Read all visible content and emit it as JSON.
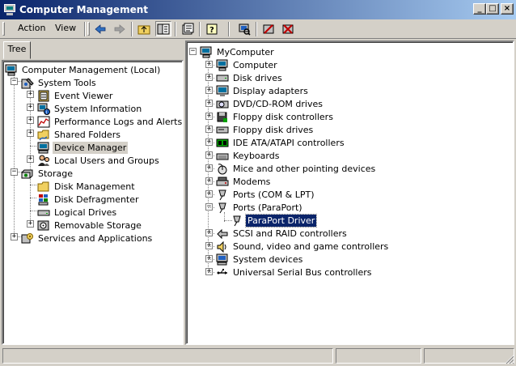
{
  "window": {
    "title": "Computer Management"
  },
  "menu": {
    "action": "Action",
    "view": "View"
  },
  "tabs": {
    "tree": "Tree"
  },
  "left_tree": {
    "root": "Computer Management (Local)",
    "system_tools": "System Tools",
    "event_viewer": "Event Viewer",
    "system_information": "System Information",
    "perf_logs": "Performance Logs and Alerts",
    "shared_folders": "Shared Folders",
    "device_manager": "Device Manager",
    "local_users": "Local Users and Groups",
    "storage": "Storage",
    "disk_management": "Disk Management",
    "disk_defrag": "Disk Defragmenter",
    "logical_drives": "Logical Drives",
    "removable_storage": "Removable Storage",
    "services_apps": "Services and Applications"
  },
  "device_tree": {
    "root": "MyComputer",
    "categories": [
      {
        "label": "Computer",
        "icon": "computer-icon"
      },
      {
        "label": "Disk drives",
        "icon": "disk-drive-icon"
      },
      {
        "label": "Display adapters",
        "icon": "display-adapter-icon"
      },
      {
        "label": "DVD/CD-ROM drives",
        "icon": "cdrom-icon"
      },
      {
        "label": "Floppy disk controllers",
        "icon": "floppy-controller-icon"
      },
      {
        "label": "Floppy disk drives",
        "icon": "floppy-drive-icon"
      },
      {
        "label": "IDE ATA/ATAPI controllers",
        "icon": "ide-controller-icon"
      },
      {
        "label": "Keyboards",
        "icon": "keyboard-icon"
      },
      {
        "label": "Mice and other pointing devices",
        "icon": "mouse-icon"
      },
      {
        "label": "Modems",
        "icon": "modem-icon"
      },
      {
        "label": "Ports (COM & LPT)",
        "icon": "port-icon"
      },
      {
        "label": "Ports (ParaPort)",
        "icon": "port-icon"
      },
      {
        "label": "SCSI and RAID controllers",
        "icon": "scsi-icon"
      },
      {
        "label": "Sound, video and game controllers",
        "icon": "sound-icon"
      },
      {
        "label": "System devices",
        "icon": "system-device-icon"
      },
      {
        "label": "Universal Serial Bus controllers",
        "icon": "usb-icon"
      }
    ],
    "child_paraport": "ParaPort Driver"
  },
  "colors": {
    "title_start": "#0a246a",
    "title_end": "#a6caf0",
    "selection": "#0a246a",
    "face": "#d4d0c8"
  }
}
